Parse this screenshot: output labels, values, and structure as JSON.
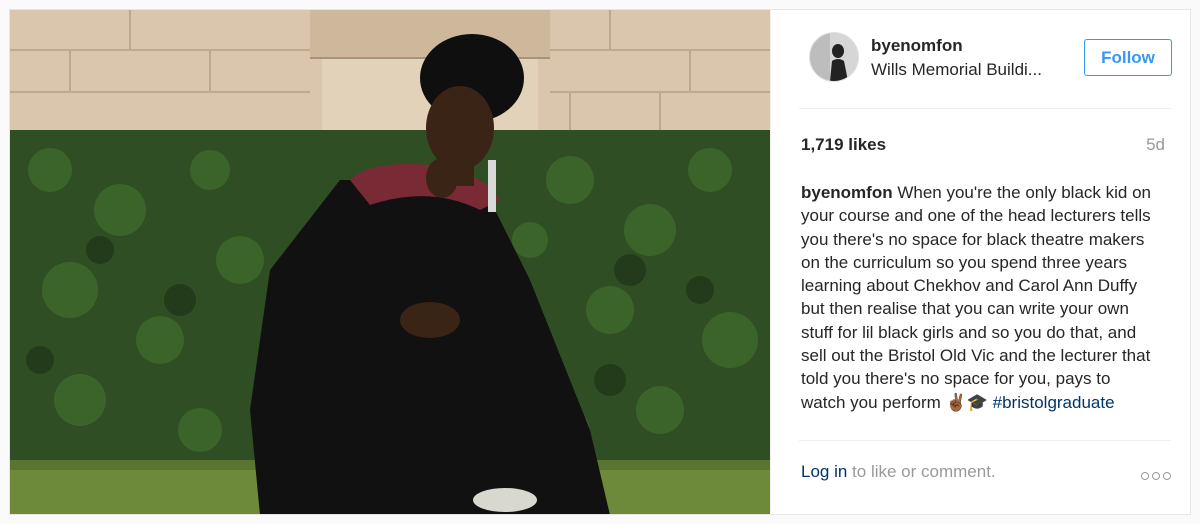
{
  "post": {
    "username": "byenomfon",
    "location": "Wills Memorial Buildi...",
    "follow_label": "Follow",
    "likes": "1,719 likes",
    "age": "5d",
    "caption": {
      "user": "byenomfon",
      "text": " When you're the only black kid on your course and one of the head lecturers tells you there's no space for black theatre makers on the curriculum so you spend three years learning about Chekhov and Carol Ann Duffy but then realise that you can write your own stuff for lil black girls and so you do that, and sell out the Bristol Old Vic and the lecturer that told you there's no space for you, pays to watch you perform ",
      "emoji": "✌🏾🎓",
      "hashtag": "#bristolgraduate"
    },
    "login_link": "Log in",
    "login_text": " to like or comment.",
    "more_icon": "ellipsis-icon"
  },
  "colors": {
    "accent": "#3897f0",
    "link": "#003569",
    "muted": "#999999",
    "text": "#262626"
  }
}
